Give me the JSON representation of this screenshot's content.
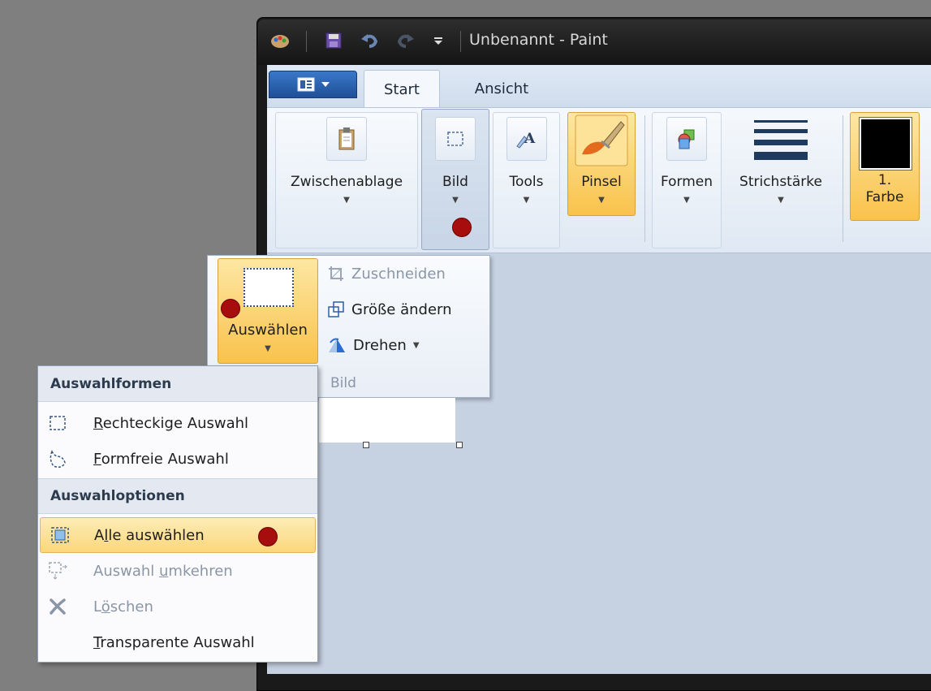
{
  "window": {
    "title": "Unbenannt - Paint"
  },
  "tabs": [
    {
      "label": "Start"
    },
    {
      "label": "Ansicht"
    }
  ],
  "ribbon": {
    "zwischenablage": "Zwischenablage",
    "bild": "Bild",
    "tools": "Tools",
    "pinsel": "Pinsel",
    "formen": "Formen",
    "strichstaerke": "Strichstärke",
    "farbe1_line1": "1.",
    "farbe1_line2": "Farbe"
  },
  "bild_panel": {
    "auswaehlen": "Auswählen",
    "zuschneiden": "Zuschneiden",
    "groesse_aendern": "Größe ändern",
    "drehen": "Drehen",
    "group_label": "Bild"
  },
  "selection_menu": {
    "section1": "Auswahlformen",
    "rechteckig": {
      "accel": "R",
      "rest": "echteckige Auswahl"
    },
    "formfrei": {
      "accel": "F",
      "rest": "ormfreie Auswahl"
    },
    "section2": "Auswahloptionen",
    "alle": {
      "pre": "A",
      "accel": "l",
      "rest": "le auswählen"
    },
    "umkehren": {
      "pre": "Auswahl ",
      "accel": "u",
      "rest": "mkehren"
    },
    "loeschen": {
      "pre": "L",
      "accel": "ö",
      "rest": "schen"
    },
    "transparent": {
      "accel": "T",
      "rest": "ransparente Auswahl"
    }
  },
  "colors": {
    "accent": "#f9c24b",
    "marker": "#a80d0d"
  }
}
